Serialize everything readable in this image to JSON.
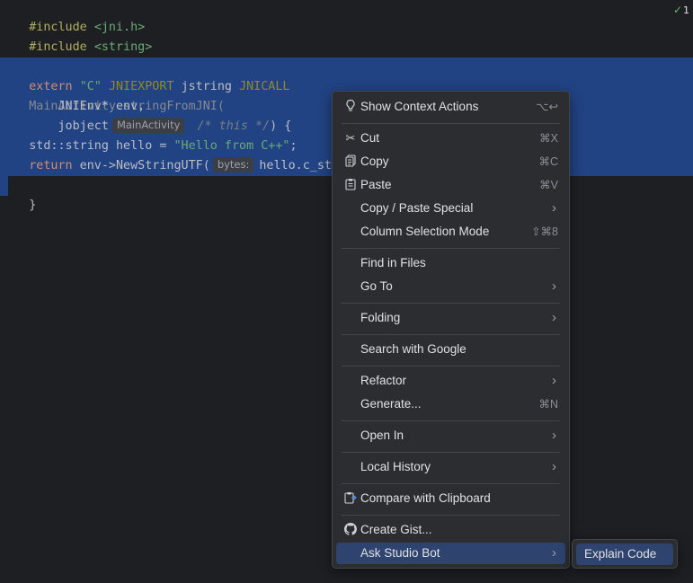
{
  "status": {
    "check_count": "1"
  },
  "code": {
    "line1": {
      "directive": "#include",
      "path": "<jni.h>"
    },
    "line2": {
      "directive": "#include",
      "path": "<string>"
    },
    "line4": {
      "kw": "extern",
      "str": "\"C\"",
      "macro1": "JNIEXPORT",
      "type": "jstring",
      "macro2": "JNICALL"
    },
    "line5": {
      "text": "MainActivity.stringFromJNI("
    },
    "line6": {
      "text": "JNIEnv* env,"
    },
    "line7": {
      "type": "jobject",
      "hint": "MainActivity",
      "comment": "/* this */",
      "rest": ") {"
    },
    "line8": {
      "decl": "std::string hello = ",
      "str": "\"Hello from C++\"",
      "end": ";"
    },
    "line9": {
      "kw": "return",
      "call": " env->NewStringUTF(",
      "hint": "bytes:",
      "arg": "hello.c_str"
    },
    "line10": {
      "text": "}"
    }
  },
  "menu": {
    "show_context_actions": {
      "label": "Show Context Actions",
      "shortcut": "⌥↩"
    },
    "cut": {
      "label": "Cut",
      "shortcut": "⌘X"
    },
    "copy": {
      "label": "Copy",
      "shortcut": "⌘C"
    },
    "paste": {
      "label": "Paste",
      "shortcut": "⌘V"
    },
    "copy_paste_special": {
      "label": "Copy / Paste Special"
    },
    "column_selection": {
      "label": "Column Selection Mode",
      "shortcut": "⇧⌘8"
    },
    "find_in_files": {
      "label": "Find in Files"
    },
    "go_to": {
      "label": "Go To"
    },
    "folding": {
      "label": "Folding"
    },
    "search_google": {
      "label": "Search with Google"
    },
    "refactor": {
      "label": "Refactor"
    },
    "generate": {
      "label": "Generate...",
      "shortcut": "⌘N"
    },
    "open_in": {
      "label": "Open In"
    },
    "local_history": {
      "label": "Local History"
    },
    "compare_clipboard": {
      "label": "Compare with Clipboard"
    },
    "create_gist": {
      "label": "Create Gist..."
    },
    "ask_studio_bot": {
      "label": "Ask Studio Bot"
    }
  },
  "submenu": {
    "explain_code": {
      "label": "Explain Code"
    }
  },
  "colors": {
    "editor_bg": "#1e1f22",
    "selection": "#214283",
    "menu_bg": "#2b2d30",
    "menu_active": "#2e436e"
  }
}
